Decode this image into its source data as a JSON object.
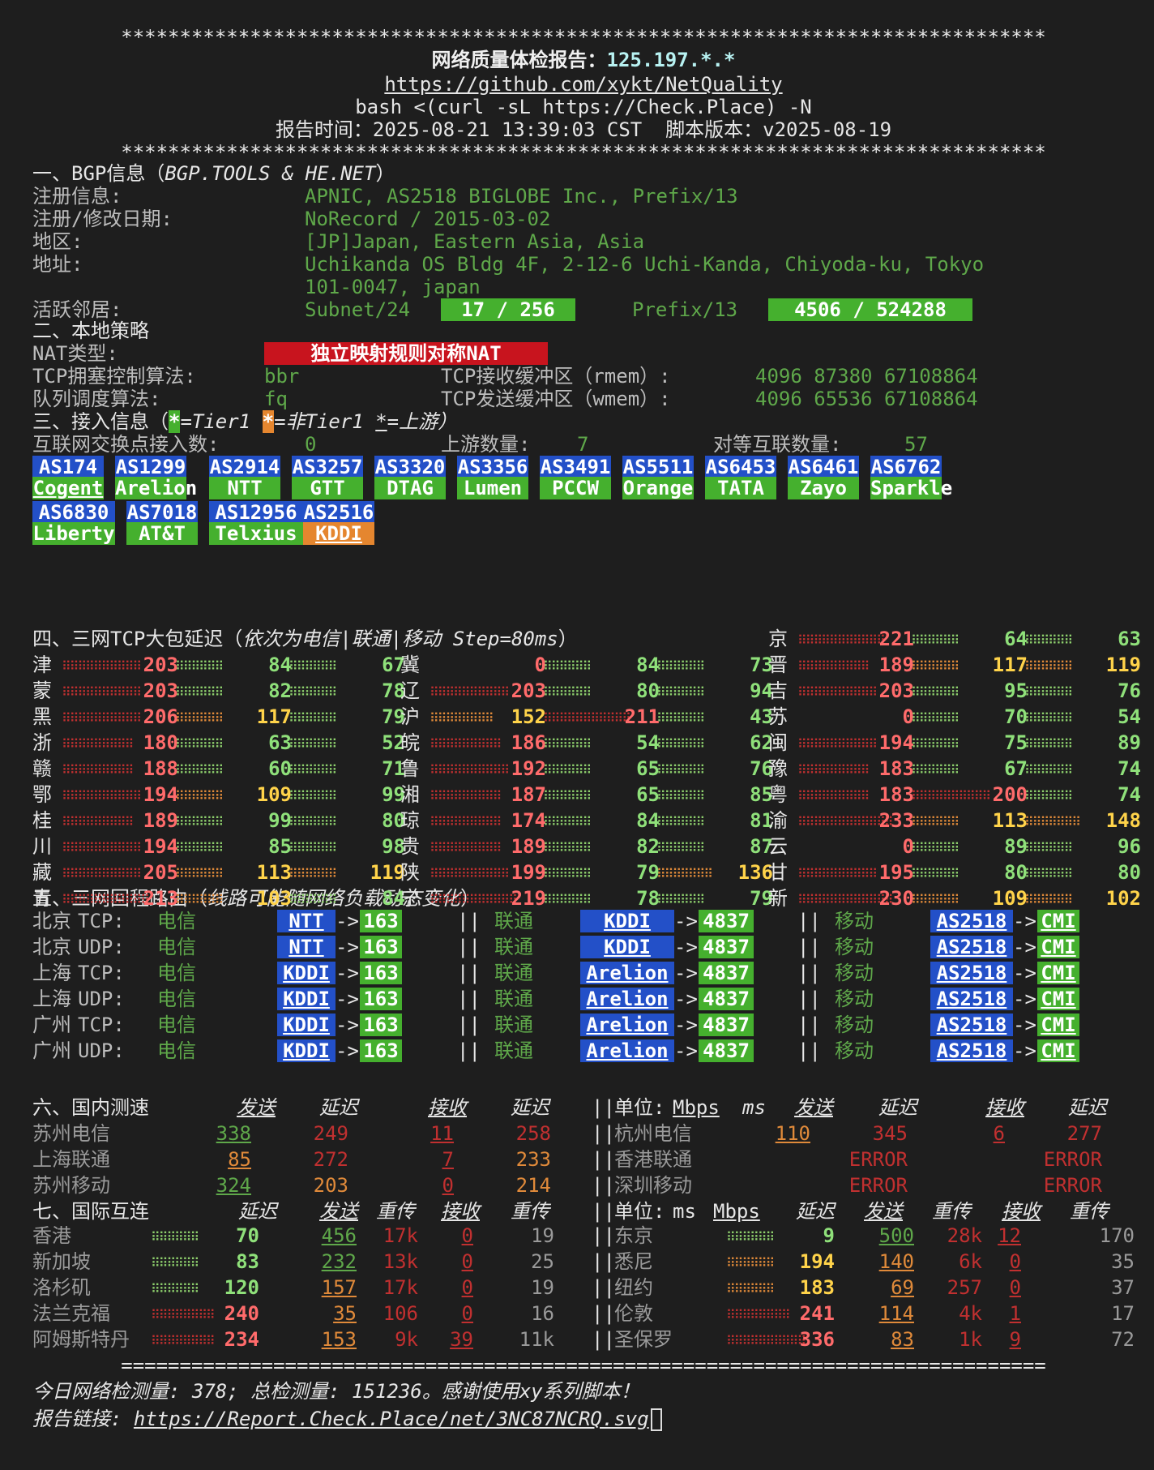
{
  "frame": {
    "stars": "*******************************************************************************",
    "equals": "==============================================================================="
  },
  "header": {
    "title_label": "网络质量体检报告：",
    "title_ip": "125.197.*.*",
    "repo_link": "https://github.com/xykt/NetQuality",
    "command": "bash <(curl -sL https://Check.Place) -N",
    "time_label": "报告时间：",
    "time_value": "2025-08-21 13:39:03 CST",
    "version_label": "脚本版本：",
    "version_value": "v2025-08-19"
  },
  "bgp": {
    "heading": "一、BGP信息（",
    "heading_src": "BGP.TOOLS & HE.NET",
    "heading_end": "）",
    "reg_label": "注册信息:",
    "reg_value": "APNIC, AS2518 BIGLOBE Inc., Prefix/13",
    "date_label": "注册/修改日期:",
    "date_value": "NoRecord / 2015-03-02",
    "region_label": "地区:",
    "region_value": "[JP]Japan, Eastern Asia, Asia",
    "addr_label": "地址:",
    "addr_value_1": "Uchikanda OS Bldg 4F, 2-12-6 Uchi-Kanda, Chiyoda-ku, Tokyo",
    "addr_value_2": "101-0047, japan",
    "neighbor_label": "活跃邻居:",
    "subnet_label": "Subnet/24",
    "subnet_value": "17 / 256",
    "prefix_label": "Prefix/13",
    "prefix_value": "4506 / 524288"
  },
  "local": {
    "heading": "二、本地策略",
    "nat_label": "NAT类型:",
    "nat_value": "独立映射规则对称NAT",
    "cc_label": "TCP拥塞控制算法:",
    "cc_value": "bbr",
    "rmem_label": "TCP接收缓冲区（rmem）:",
    "rmem_value": "4096 87380 67108864",
    "qdisc_label": "队列调度算法:",
    "qdisc_value": "fq",
    "wmem_label": "TCP发送缓冲区（wmem）:",
    "wmem_value": "4096 65536 67108864"
  },
  "access": {
    "heading": "三、接入信息（",
    "legend_t1_mark": "*",
    "legend_t1": "=Tier1",
    "legend_nt1_mark": "*",
    "legend_nt1": "=非Tier1",
    "legend_up_mark": "*",
    "legend_up": "=上游）",
    "ix_label": "互联网交换点接入数:",
    "ix_value": "0",
    "upstream_label": "上游数量:",
    "upstream_value": "7",
    "peer_label": "对等互联数量:",
    "peer_value": "57",
    "asns_row1": [
      {
        "as": "AS174",
        "name": "Cogent",
        "kind": "tier1",
        "up": true
      },
      {
        "as": "AS1299",
        "name": "Arelion",
        "kind": "tier1",
        "up": false
      },
      {
        "as": "AS2914",
        "name": "NTT",
        "kind": "tier1",
        "up": false
      },
      {
        "as": "AS3257",
        "name": "GTT",
        "kind": "tier1",
        "up": false
      },
      {
        "as": "AS3320",
        "name": "DTAG",
        "kind": "tier1",
        "up": false
      },
      {
        "as": "AS3356",
        "name": "Lumen",
        "kind": "tier1",
        "up": false
      },
      {
        "as": "AS3491",
        "name": "PCCW",
        "kind": "tier1",
        "up": false
      },
      {
        "as": "AS5511",
        "name": "Orange",
        "kind": "tier1",
        "up": false
      },
      {
        "as": "AS6453",
        "name": "TATA",
        "kind": "tier1",
        "up": false
      },
      {
        "as": "AS6461",
        "name": "Zayo",
        "kind": "tier1",
        "up": false
      },
      {
        "as": "AS6762",
        "name": "Sparkle",
        "kind": "tier1",
        "up": false
      }
    ],
    "asns_row2": [
      {
        "as": "AS6830",
        "name": "Liberty",
        "kind": "tier1",
        "up": false
      },
      {
        "as": "AS7018",
        "name": "AT&T",
        "kind": "tier1",
        "up": false
      },
      {
        "as": "AS12956",
        "name": "Telxius",
        "kind": "tier1",
        "up": false
      },
      {
        "as": "AS2516",
        "name": "KDDI",
        "kind": "non-tier1",
        "up": true
      }
    ]
  },
  "latency": {
    "heading": "四、三网TCP大包延迟（",
    "heading_note": "依次为电信|联通|移动 Step=80ms",
    "heading_end": "）",
    "rows": [
      [
        {
          "p": "京",
          "v": [
            221,
            64,
            63
          ]
        }
      ],
      [
        {
          "p": "津",
          "v": [
            203,
            84,
            67
          ]
        },
        {
          "p": "冀",
          "v": [
            0,
            84,
            73
          ]
        },
        {
          "p": "晋",
          "v": [
            189,
            117,
            119
          ]
        }
      ],
      [
        {
          "p": "蒙",
          "v": [
            203,
            82,
            78
          ]
        },
        {
          "p": "辽",
          "v": [
            203,
            80,
            94
          ]
        },
        {
          "p": "吉",
          "v": [
            203,
            95,
            76
          ]
        }
      ],
      [
        {
          "p": "黑",
          "v": [
            206,
            117,
            79
          ]
        },
        {
          "p": "沪",
          "v": [
            152,
            211,
            43
          ]
        },
        {
          "p": "苏",
          "v": [
            0,
            70,
            54
          ]
        }
      ],
      [
        {
          "p": "浙",
          "v": [
            180,
            63,
            52
          ]
        },
        {
          "p": "皖",
          "v": [
            186,
            54,
            62
          ]
        },
        {
          "p": "闽",
          "v": [
            194,
            75,
            89
          ]
        }
      ],
      [
        {
          "p": "赣",
          "v": [
            188,
            60,
            71
          ]
        },
        {
          "p": "鲁",
          "v": [
            192,
            65,
            76
          ]
        },
        {
          "p": "豫",
          "v": [
            183,
            67,
            74
          ]
        }
      ],
      [
        {
          "p": "鄂",
          "v": [
            194,
            109,
            99
          ]
        },
        {
          "p": "湘",
          "v": [
            187,
            65,
            85
          ]
        },
        {
          "p": "粤",
          "v": [
            183,
            200,
            74
          ]
        }
      ],
      [
        {
          "p": "桂",
          "v": [
            189,
            99,
            80
          ]
        },
        {
          "p": "琼",
          "v": [
            174,
            84,
            81
          ]
        },
        {
          "p": "渝",
          "v": [
            233,
            113,
            148
          ]
        }
      ],
      [
        {
          "p": "川",
          "v": [
            194,
            85,
            98
          ]
        },
        {
          "p": "贵",
          "v": [
            189,
            82,
            87
          ]
        },
        {
          "p": "云",
          "v": [
            0,
            89,
            96
          ]
        }
      ],
      [
        {
          "p": "藏",
          "v": [
            205,
            113,
            119
          ]
        },
        {
          "p": "陕",
          "v": [
            199,
            79,
            136
          ]
        },
        {
          "p": "甘",
          "v": [
            195,
            80,
            80
          ]
        }
      ],
      [
        {
          "p": "青",
          "v": [
            213,
            103,
            84
          ]
        },
        {
          "p": "宁",
          "v": [
            219,
            78,
            79
          ]
        },
        {
          "p": "新",
          "v": [
            230,
            109,
            102
          ]
        }
      ]
    ]
  },
  "route": {
    "heading": "五、三网回程路由（",
    "heading_note": "线路可能随网络负载动态变化",
    "heading_end": "）",
    "sep": "||",
    "arrow": "->",
    "rows": [
      {
        "loc": "北京",
        "proto": "TCP:",
        "ct_label": "电信",
        "ct_as": "NTT",
        "ct_end": "163",
        "cu_label": "联通",
        "cu_as": "KDDI",
        "cu_end": "4837",
        "cm_label": "移动",
        "cm_as": "AS2518",
        "cm_end": "CMI"
      },
      {
        "loc": "北京",
        "proto": "UDP:",
        "ct_label": "电信",
        "ct_as": "NTT",
        "ct_end": "163",
        "cu_label": "联通",
        "cu_as": "KDDI",
        "cu_end": "4837",
        "cm_label": "移动",
        "cm_as": "AS2518",
        "cm_end": "CMI"
      },
      {
        "loc": "上海",
        "proto": "TCP:",
        "ct_label": "电信",
        "ct_as": "KDDI",
        "ct_end": "163",
        "cu_label": "联通",
        "cu_as": "Arelion",
        "cu_end": "4837",
        "cm_label": "移动",
        "cm_as": "AS2518",
        "cm_end": "CMI"
      },
      {
        "loc": "上海",
        "proto": "UDP:",
        "ct_label": "电信",
        "ct_as": "KDDI",
        "ct_end": "163",
        "cu_label": "联通",
        "cu_as": "Arelion",
        "cu_end": "4837",
        "cm_label": "移动",
        "cm_as": "AS2518",
        "cm_end": "CMI"
      },
      {
        "loc": "广州",
        "proto": "TCP:",
        "ct_label": "电信",
        "ct_as": "KDDI",
        "ct_end": "163",
        "cu_label": "联通",
        "cu_as": "Arelion",
        "cu_end": "4837",
        "cm_label": "移动",
        "cm_as": "AS2518",
        "cm_end": "CMI"
      },
      {
        "loc": "广州",
        "proto": "UDP:",
        "ct_label": "电信",
        "ct_as": "KDDI",
        "ct_end": "163",
        "cu_label": "联通",
        "cu_as": "Arelion",
        "cu_end": "4837",
        "cm_label": "移动",
        "cm_as": "AS2518",
        "cm_end": "CMI"
      }
    ]
  },
  "domestic": {
    "heading": "六、国内测速",
    "h_send": "发送",
    "h_delay": "延迟",
    "h_recv": "接收",
    "h_delay2": "延迟",
    "unit_label": "单位:",
    "unit_mbps": "Mbps",
    "unit_ms": "ms",
    "sep": "||",
    "left": [
      {
        "name": "苏州电信",
        "send": "338",
        "sdelay": "249",
        "recv": "11",
        "rdelay": "258"
      },
      {
        "name": "上海联通",
        "send": "85",
        "sdelay": "272",
        "recv": "7",
        "rdelay": "233"
      },
      {
        "name": "苏州移动",
        "send": "324",
        "sdelay": "203",
        "recv": "0",
        "rdelay": "214"
      }
    ],
    "right": [
      {
        "name": "杭州电信",
        "send": "110",
        "sdelay": "345",
        "recv": "6",
        "rdelay": "277"
      },
      {
        "name": "香港联通",
        "send": "",
        "sdelay": "ERROR",
        "recv": "",
        "rdelay": "ERROR"
      },
      {
        "name": "深圳移动",
        "send": "",
        "sdelay": "ERROR",
        "recv": "",
        "rdelay": "ERROR"
      }
    ]
  },
  "intl": {
    "heading": "七、国际互连",
    "h_delay": "延迟",
    "h_send": "发送",
    "h_retx": "重传",
    "h_recv": "接收",
    "h_retx2": "重传",
    "unit_label": "单位:",
    "unit_ms": "ms",
    "unit_mbps": "Mbps",
    "sep": "||",
    "left": [
      {
        "city": "香港",
        "delay": "70",
        "send": "456",
        "sretx": "17k",
        "recv": "0",
        "rretx": "19"
      },
      {
        "city": "新加坡",
        "delay": "83",
        "send": "232",
        "sretx": "13k",
        "recv": "0",
        "rretx": "25"
      },
      {
        "city": "洛杉矶",
        "delay": "120",
        "send": "157",
        "sretx": "17k",
        "recv": "0",
        "rretx": "19"
      },
      {
        "city": "法兰克福",
        "delay": "240",
        "send": "35",
        "sretx": "106",
        "recv": "0",
        "rretx": "16"
      },
      {
        "city": "阿姆斯特丹",
        "delay": "234",
        "send": "153",
        "sretx": "9k",
        "recv": "39",
        "rretx": "11k"
      }
    ],
    "right": [
      {
        "city": "东京",
        "delay": "9",
        "send": "500",
        "sretx": "28k",
        "recv": "12",
        "rretx": "170"
      },
      {
        "city": "悉尼",
        "delay": "194",
        "send": "140",
        "sretx": "6k",
        "recv": "0",
        "rretx": "35"
      },
      {
        "city": "纽约",
        "delay": "183",
        "send": "69",
        "sretx": "257",
        "recv": "0",
        "rretx": "37"
      },
      {
        "city": "伦敦",
        "delay": "241",
        "send": "114",
        "sretx": "4k",
        "recv": "1",
        "rretx": "17"
      },
      {
        "city": "圣保罗",
        "delay": "336",
        "send": "83",
        "sretx": "1k",
        "recv": "9",
        "rretx": "72"
      }
    ]
  },
  "footer": {
    "count_text": "今日网络检测量: 378; 总检测量: 151236。感谢使用xy系列脚本！",
    "link_label": "报告链接:",
    "link_url": "https://Report.Check.Place/net/3NC87NCRQ.svg"
  },
  "colors": {
    "background": "#1e1e1e",
    "tier1_green": "#45b02e",
    "asn_blue": "#2350c8",
    "nontier1_orange": "#e5862f",
    "nat_red": "#c8141e",
    "latency_green": "#8fe07a",
    "latency_yellow": "#ffd34a",
    "latency_red": "#ff6b6b"
  }
}
